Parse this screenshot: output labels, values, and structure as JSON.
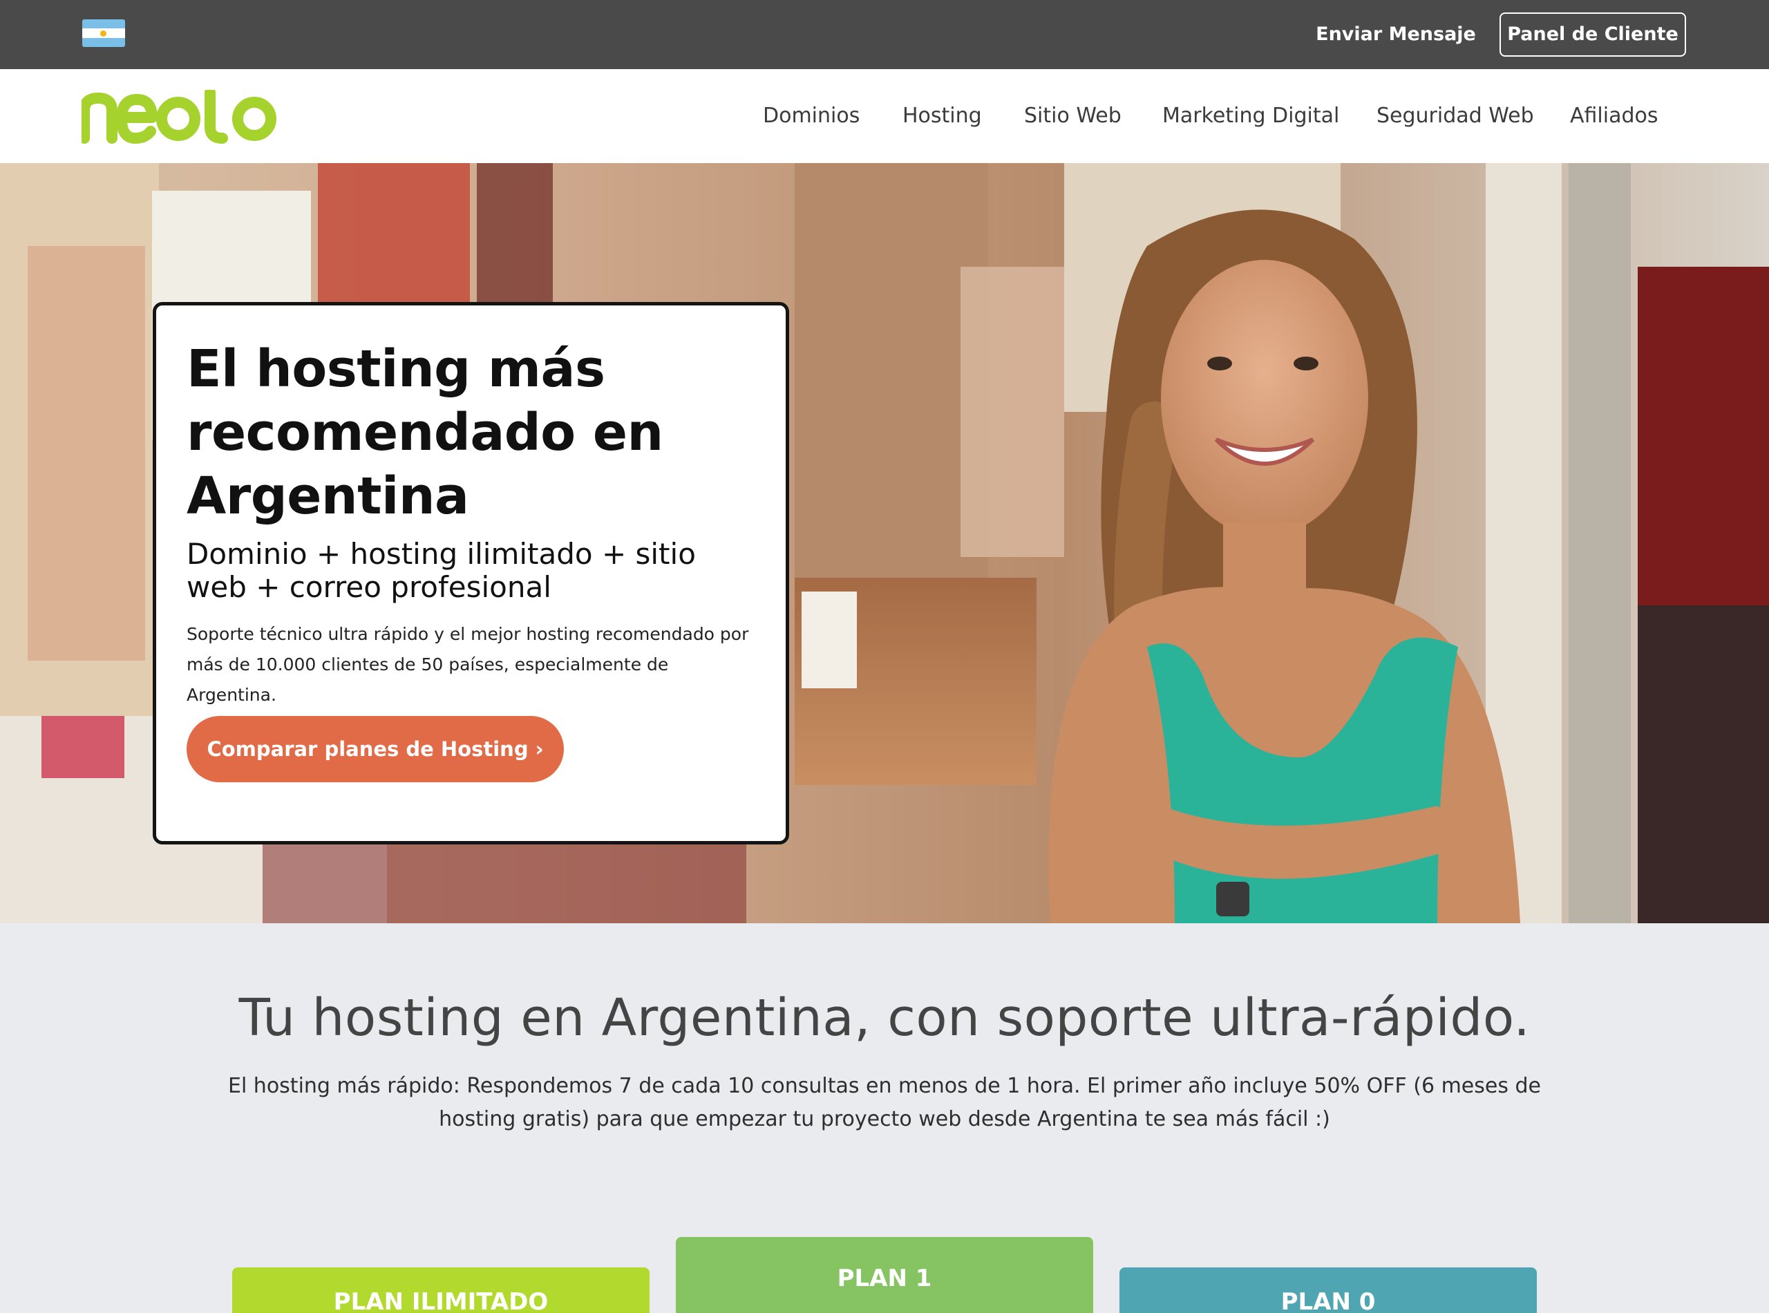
{
  "topbar": {
    "flag_icon": "argentina-flag-icon",
    "send_message": "Enviar Mensaje",
    "client_panel": "Panel de Cliente"
  },
  "brand": {
    "logo_text": "neolo",
    "logo_color": "#a6d22e"
  },
  "nav": {
    "items": [
      {
        "label": "Dominios"
      },
      {
        "label": "Hosting"
      },
      {
        "label": "Sitio Web"
      },
      {
        "label": "Marketing Digital"
      },
      {
        "label": "Seguridad Web"
      },
      {
        "label": "Afiliados"
      }
    ]
  },
  "hero": {
    "title": "El hosting más recomendado en Argentina",
    "subtitle": "Dominio + hosting ilimitado + sitio web + correo profesional",
    "text": "Soporte técnico ultra rápido y el mejor hosting recomendado por más de 10.000 clientes de 50 países, especialmente de Argentina.",
    "cta_label": "Comparar planes de Hosting",
    "cta_icon": "chevron-right-icon",
    "cta_color": "#e26b47",
    "image_description_icon": "hero-photo"
  },
  "section": {
    "title": "Tu hosting en Argentina, con soporte ultra-rápido.",
    "text": "El hosting más rápido: Respondemos 7 de cada 10 consultas en menos de 1 hora. El primer año incluye 50% OFF (6 meses de hosting gratis) para que empezar tu proyecto web desde Argentina te sea más fácil :)"
  },
  "plans": [
    {
      "label": "PLAN ILIMITADO",
      "color": "#b2da2e"
    },
    {
      "label": "PLAN 1",
      "color": "#86c463"
    },
    {
      "label": "PLAN 0",
      "color": "#4fa5b1"
    }
  ]
}
